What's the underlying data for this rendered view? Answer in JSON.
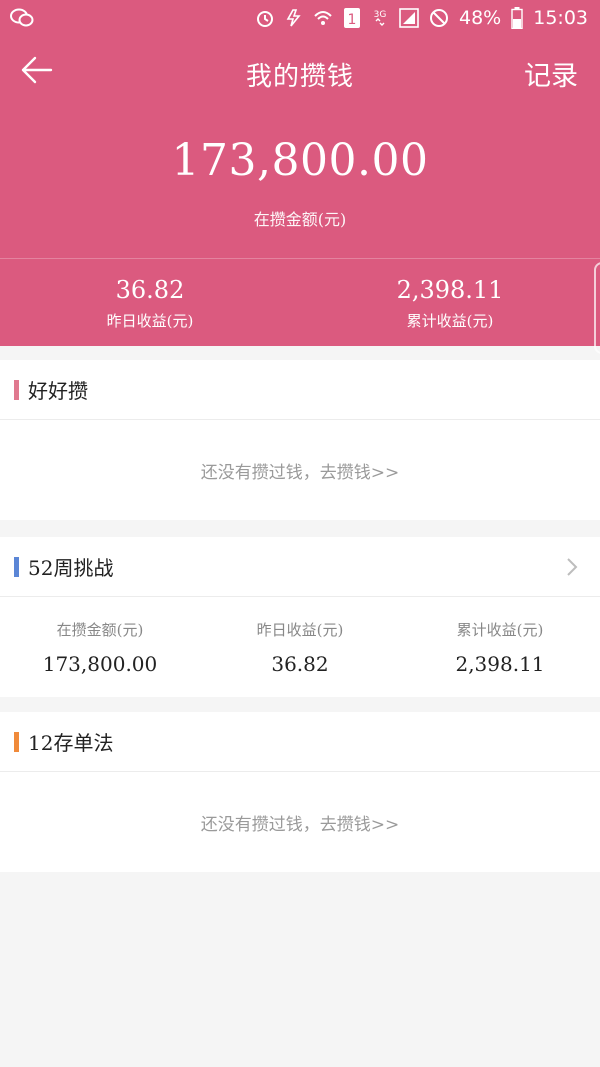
{
  "status_bar": {
    "battery": "48%",
    "time": "15:03",
    "network": "3G",
    "sim": "1",
    "colors": {
      "text": "#ffffff"
    }
  },
  "nav": {
    "title": "我的攒钱",
    "record": "记录",
    "back_icon": "arrow-left-icon"
  },
  "summary": {
    "total_amount": "173,800.00",
    "total_label": "在攒金额(元)",
    "yesterday_value": "36.82",
    "yesterday_label": "昨日收益(元)",
    "cumulative_value": "2,398.11",
    "cumulative_label": "累计收益(元)"
  },
  "sections": {
    "haohaozan": {
      "title": "好好攒",
      "empty_text": "还没有攒过钱，去攒钱>>",
      "accent": "#e0798f"
    },
    "week52": {
      "title": "52周挑战",
      "accent": "#5b86d6",
      "stats": [
        {
          "label": "在攒金额(元)",
          "value": "173,800.00"
        },
        {
          "label": "昨日收益(元)",
          "value": "36.82"
        },
        {
          "label": "累计收益(元)",
          "value": "2,398.11"
        }
      ]
    },
    "deposit12": {
      "title": "12存单法",
      "empty_text": "还没有攒过钱，去攒钱>>",
      "accent": "#f08a3a"
    }
  },
  "colors": {
    "brand": "#db5a7f",
    "background": "#f5f5f5"
  }
}
